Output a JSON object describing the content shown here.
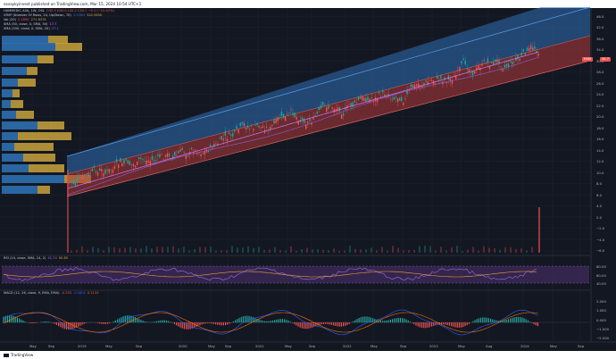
{
  "header": {
    "publish_text": "savaykyinvest published on TradingView.com, Mar 15, 2024 10:54 UTC+1"
  },
  "legend": {
    "symbol": "HAMMEDIC ASA, 1W, OSL",
    "ohlc": "O35.0 H40.0 L35.2 C34.7 −4.1 (−10.57%)",
    "vrvp": {
      "label": "VRVP (Number Of Rows, 24, Up/Down, 70)",
      "v1": "3.958M",
      "v2": "542.665K"
    },
    "vol": {
      "label": "Vol (20)",
      "v1": "2.185K",
      "v2": "271.837K"
    },
    "sma1": {
      "label": "SMA (50, close, 0, SMA, 50)",
      "v1": "17.7"
    },
    "sma2": {
      "label": "SMA (200, close, 0, SMA, 20)",
      "v1": "37.1"
    },
    "rsi": {
      "label": "RSI (14, close, SMA, 14, 2)",
      "v1": "41.74",
      "v2": "50.85"
    },
    "macd": {
      "label": "MACD (12, 26, close, 9, EMA, EMA)",
      "v1": "-0.333",
      "v2": "-0.5800",
      "v3": "0.1133"
    }
  },
  "colors": {
    "bg": "#131722",
    "up": "#26a69a",
    "down": "#ef5350",
    "channel_up": "#2f6fb5",
    "channel_down": "#b33a3a",
    "vp_up": "#2d6fb0",
    "vp_down": "#c9a23b",
    "rsi_band": "#4b2f6b",
    "sma_fast": "#d27bff",
    "price_tag": "#ef5350"
  },
  "price_axis": {
    "ticks": [
      "46.0",
      "42.0",
      "38.0",
      "34.0",
      "30.0",
      "28.0",
      "26.0",
      "24.0",
      "22.0",
      "20.0",
      "18.0",
      "16.0",
      "14.0",
      "12.0",
      "10.0",
      "8.0",
      "6.0",
      "4.0",
      "2.0",
      "−2.0",
      "−4.0",
      "−6.0"
    ],
    "last_price": "34.7",
    "symbol_tag": "HAM"
  },
  "rsi_axis": {
    "ticks": [
      "80.00",
      "60.00",
      "40.00"
    ]
  },
  "macd_axis": {
    "ticks": [
      "2.000",
      "1.000",
      "0.000",
      "−1.000",
      "−2.000"
    ]
  },
  "time_axis": {
    "ticks": [
      "May",
      "Sep",
      "2019",
      "May",
      "Sep",
      "2020",
      "May",
      "Sep",
      "2021",
      "May",
      "Sep",
      "2022",
      "May",
      "Sep",
      "2023",
      "May",
      "Aug",
      "2024",
      "May",
      "Sep"
    ]
  },
  "footer": {
    "logo_text": "TradingView"
  }
}
